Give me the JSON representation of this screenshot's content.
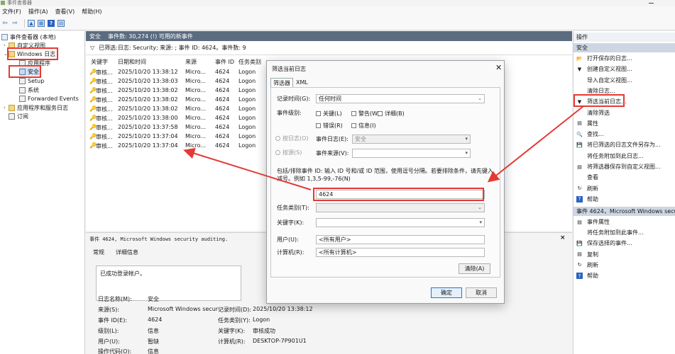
{
  "window": {
    "title": "事件查看器"
  },
  "menu": [
    "文件(F)",
    "操作(A)",
    "查看(V)",
    "帮助(H)"
  ],
  "toolbar": {
    "back": "⇦",
    "forward": "⇨",
    "help": "?"
  },
  "tree": {
    "root": "事件查看器 (本地)",
    "custom_views": "自定义视图",
    "windows_logs": "Windows 日志",
    "application": "应用程序",
    "security": "安全",
    "setup": "Setup",
    "system": "系统",
    "forwarded": "Forwarded Events",
    "apps_services": "应用程序和服务日志",
    "subscriptions": "订阅"
  },
  "main": {
    "header_name": "安全",
    "header_count": "事件数: 30,274 (!) 可用的新事件",
    "filter_text": "已筛选:日志: Security; 来源: ; 事件 ID: 4624。事件数: 9",
    "columns": [
      "关键字",
      "日期和时间",
      "来源",
      "事件 ID",
      "任务类别"
    ],
    "rows": [
      [
        "审核...",
        "2025/10/20 13:38:12",
        "Micro...",
        "4624",
        "Logon"
      ],
      [
        "审核...",
        "2025/10/20 13:38:03",
        "Micro...",
        "4624",
        "Logon"
      ],
      [
        "审核...",
        "2025/10/20 13:38:02",
        "Micro...",
        "4624",
        "Logon"
      ],
      [
        "审核...",
        "2025/10/20 13:38:02",
        "Micro...",
        "4624",
        "Logon"
      ],
      [
        "审核...",
        "2025/10/20 13:38:02",
        "Micro...",
        "4624",
        "Logon"
      ],
      [
        "审核...",
        "2025/10/20 13:38:00",
        "Micro...",
        "4624",
        "Logon"
      ],
      [
        "审核...",
        "2025/10/20 13:37:58",
        "Micro...",
        "4624",
        "Logon"
      ],
      [
        "审核...",
        "2025/10/20 13:37:04",
        "Micro...",
        "4624",
        "Logon"
      ],
      [
        "审核...",
        "2025/10/20 13:37:04",
        "Micro...",
        "4624",
        "Logon"
      ]
    ]
  },
  "detail": {
    "title": "事件 4624, Microsoft Windows security auditing.",
    "close": "×",
    "tab_general": "常规",
    "tab_details": "详细信息",
    "message": "已成功登录帐户。",
    "fields": {
      "log_name_label": "日志名称(M):",
      "log_name": "安全",
      "source_label": "来源(S):",
      "source": "Microsoft Windows secur",
      "logged_label": "记录时间(D):",
      "logged": "2025/10/20 13:38:12",
      "event_id_label": "事件 ID(E):",
      "event_id": "4624",
      "task_label": "任务类别(Y):",
      "task": "Logon",
      "level_label": "级别(L):",
      "level": "信息",
      "keywords_label": "关键字(K):",
      "keywords": "审核成功",
      "user_label": "用户(U):",
      "user": "暂缺",
      "computer_label": "计算机(R):",
      "computer": "DESKTOP-7P901U1",
      "opcode_label": "操作代码(O):",
      "opcode": "信息"
    }
  },
  "dialog": {
    "title": "筛选当前日志",
    "close": "✕",
    "tab_filter": "筛选器",
    "tab_xml": "XML",
    "logged_label": "记录时间(G):",
    "logged_value": "任何时间",
    "level_label": "事件级别:",
    "levels": [
      "关键(L)",
      "警告(W)",
      "详细(B)",
      "错误(R)",
      "信息(I)"
    ],
    "by_log": "按日志(O)",
    "event_logs_label": "事件日志(E):",
    "event_logs_value": "安全",
    "by_source": "按源(S)",
    "event_sources_label": "事件来源(V):",
    "includes_text_1": "包括/排除事件 ID: 输入 ID 号和/或 ID 范围，使用逗号分隔。若要排除条件，请先键入",
    "includes_text_2": "减号。例如 1,3,5-99,-76(N)",
    "event_id_value": "4624",
    "task_label": "任务类别(T):",
    "keywords_label": "关键字(K):",
    "user_label": "用户(U):",
    "user_value": "<所有用户>",
    "computer_label": "计算机(R):",
    "computer_value": "<所有计算机>",
    "clear": "清除(A)",
    "ok": "确定",
    "cancel": "取消"
  },
  "actions": {
    "header": "操作",
    "section1": "安全",
    "items1": [
      "打开保存的日志...",
      "创建自定义视图...",
      "导入自定义视图...",
      "清除日志...",
      "筛选当前日志...",
      "清除筛选",
      "属性",
      "查找...",
      "将已筛选的日志文件另存为...",
      "将任务附加到此日志...",
      "将筛选器保存到自定义视图...",
      "查看",
      "刷新",
      "帮助"
    ],
    "section2": "事件 4624，Microsoft Windows securit",
    "items2": [
      "事件属性",
      "将任务附加到此事件...",
      "保存选择的事件...",
      "复制",
      "刷新",
      "帮助"
    ]
  },
  "colors": {
    "annotation": "#e53935",
    "header_bg": "#5b6b80"
  }
}
